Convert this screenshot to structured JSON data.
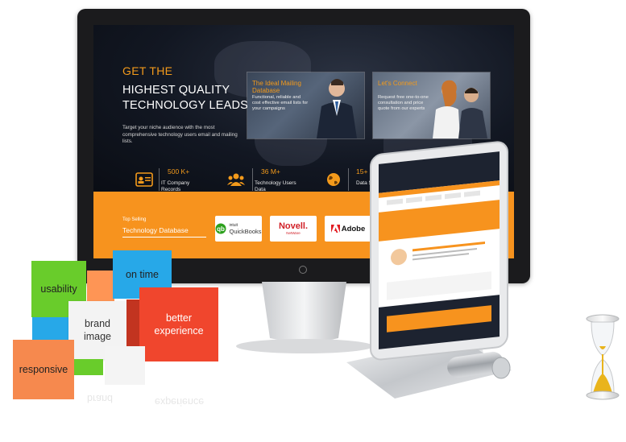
{
  "hero": {
    "kicker": "GET THE",
    "headline_line1": "HIGHEST QUALITY",
    "headline_line2": "TECHNOLOGY LEADS",
    "subtext": "Target your niche audience with the most comprehensive technology users email and mailing lists."
  },
  "cards": [
    {
      "title": "The Ideal Mailing Database",
      "body": "Functional, reliable and cost effective email lists for your campaigns"
    },
    {
      "title": "Let's Connect",
      "body": "Request free one-to-one consultation and price quote from our experts"
    }
  ],
  "stats": [
    {
      "value": "500 K+",
      "label": "IT Company Records",
      "icon": "id-card-icon"
    },
    {
      "value": "36 M+",
      "label": "Technology Users Data",
      "icon": "users-icon"
    },
    {
      "value": "15+",
      "label": "Data Selects",
      "icon": "database-icon"
    }
  ],
  "selling": {
    "caption": "Top Selling",
    "field_value": "Technology Database"
  },
  "logos": [
    {
      "name": "intuit QuickBooks",
      "small": "intuit",
      "main": "QuickBooks"
    },
    {
      "name": "Novell",
      "main": "Novell.",
      "small": "NetWare"
    },
    {
      "name": "Adobe",
      "main": "Adobe"
    }
  ],
  "blocks": {
    "usability": "usability",
    "on_time": "on time",
    "brand_image_1": "brand",
    "brand_image_2": "image",
    "better_experience_1": "better",
    "better_experience_2": "experience",
    "responsive": "responsive"
  },
  "colors": {
    "accent": "#f7931e",
    "green": "#69cc2b",
    "blue": "#27a8e8",
    "red": "#f0462d",
    "orange_block": "#f6894e"
  }
}
